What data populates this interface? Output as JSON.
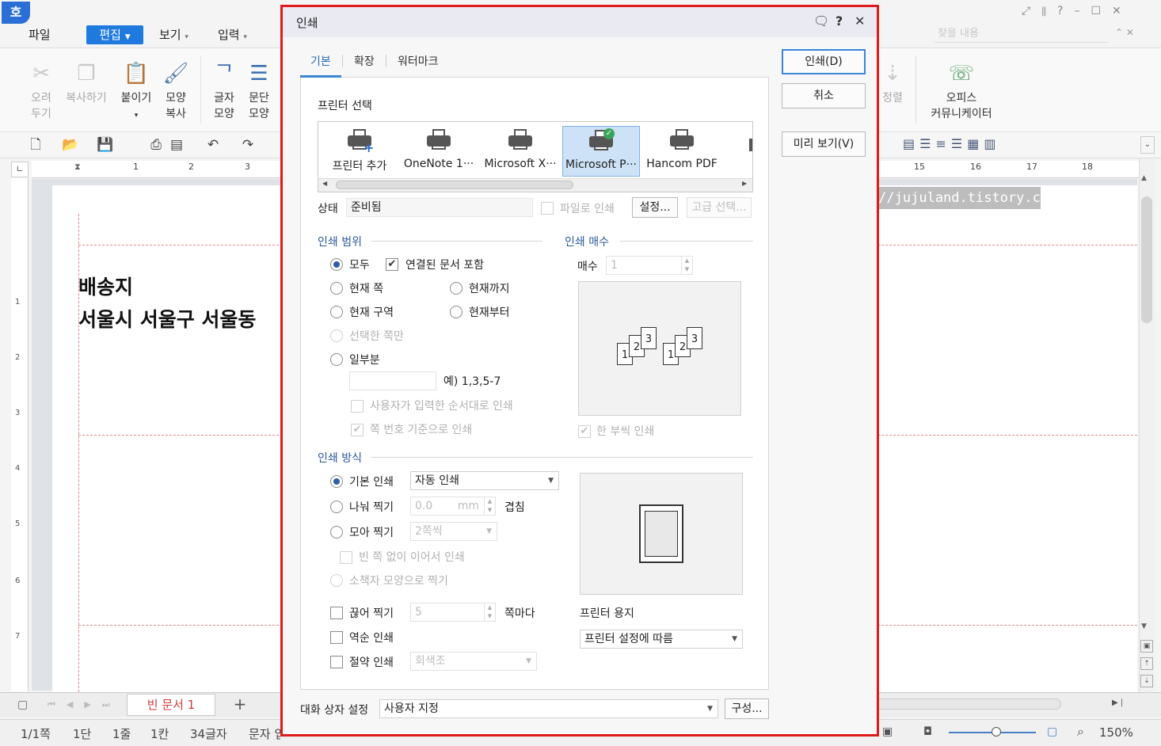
{
  "app": {
    "logo": "호",
    "menu": {
      "file": "파일",
      "edit": "편집",
      "view": "보기",
      "insert": "입력"
    },
    "ribbon": {
      "cut": [
        "오려",
        "두기"
      ],
      "copy": "복사하기",
      "paste": "붙이기",
      "format_copy": [
        "모양",
        "복사"
      ],
      "char_shape": [
        "글자",
        "모양"
      ],
      "para_shape": [
        "문단",
        "모양"
      ],
      "align": "정렬",
      "office_community": [
        "오피스",
        "커뮤니케이터"
      ]
    },
    "search_placeholder": "찾을 내용",
    "ruler_left": [
      "1",
      "2",
      "3"
    ],
    "ruler_right": [
      "15",
      "16",
      "17",
      "18"
    ],
    "vruler": [
      "1",
      "2",
      "3",
      "4",
      "5",
      "6",
      "7"
    ],
    "document": {
      "line1": "배송지",
      "line2": "서울시 서울구 서울동"
    },
    "watermark": "http://jujuland.tistory.com",
    "doc_tab": "빈 문서 1",
    "add_tab": "+",
    "status": {
      "page": "1/1쪽",
      "section": "1단",
      "line": "1줄",
      "column": "1칸",
      "chars": "34글자",
      "mode": "문자 입",
      "zoom": "150%"
    }
  },
  "dialog": {
    "title": "인쇄",
    "tabs": [
      "기본",
      "확장",
      "워터마크"
    ],
    "printer_select": "프린터 선택",
    "printers": [
      "프린터 추가",
      "OneNote 1···",
      "Microsoft X···",
      "Microsoft P···",
      "Hancom PDF"
    ],
    "status_label": "상태",
    "status_value": "준비됨",
    "print_to_file": "파일로 인쇄",
    "settings_button": "설정...",
    "advanced_button": "고급 선택...",
    "range": {
      "heading": "인쇄 범위",
      "all": "모두",
      "include_linked": "연결된 문서 포함",
      "current_page": "현재 쪽",
      "to_current": "현재까지",
      "current_section": "현재 구역",
      "from_current": "현재부터",
      "selected_pages": "선택한 쪽만",
      "partial": "일부분",
      "partial_example": "예) 1,3,5-7",
      "user_order": "사용자가 입력한 순서대로 인쇄",
      "by_page_number": "쪽 번호 기준으로 인쇄"
    },
    "copies": {
      "heading": "인쇄 매수",
      "label": "매수",
      "value": "1",
      "collate": "한 부씩 인쇄"
    },
    "method": {
      "heading": "인쇄 방식",
      "basic": "기본 인쇄",
      "basic_value": "자동 인쇄",
      "split": "나눠 찍기",
      "split_value": "0.0",
      "split_unit": "mm",
      "overlap": "겹침",
      "gather": "모아 찍기",
      "gather_value": "2쪽씩",
      "no_blank": "빈 쪽 없이 이어서 인쇄",
      "booklet": "소책자 모양으로 찍기",
      "break": "끊어 찍기",
      "break_value": "5",
      "per_page": "쪽마다",
      "reverse": "역순 인쇄",
      "saving": "절약 인쇄",
      "saving_value": "회색조"
    },
    "paper_label": "프린터 용지",
    "paper_value": "프린터 설정에 따름",
    "preview_pages": [
      "1",
      "2",
      "3"
    ],
    "dialog_setting_label": "대화 상자 설정",
    "dialog_setting_value": "사용자 지정",
    "configure_button": "구성...",
    "print_button": "인쇄(D)",
    "cancel_button": "취소",
    "preview_button": "미리 보기(V)"
  }
}
